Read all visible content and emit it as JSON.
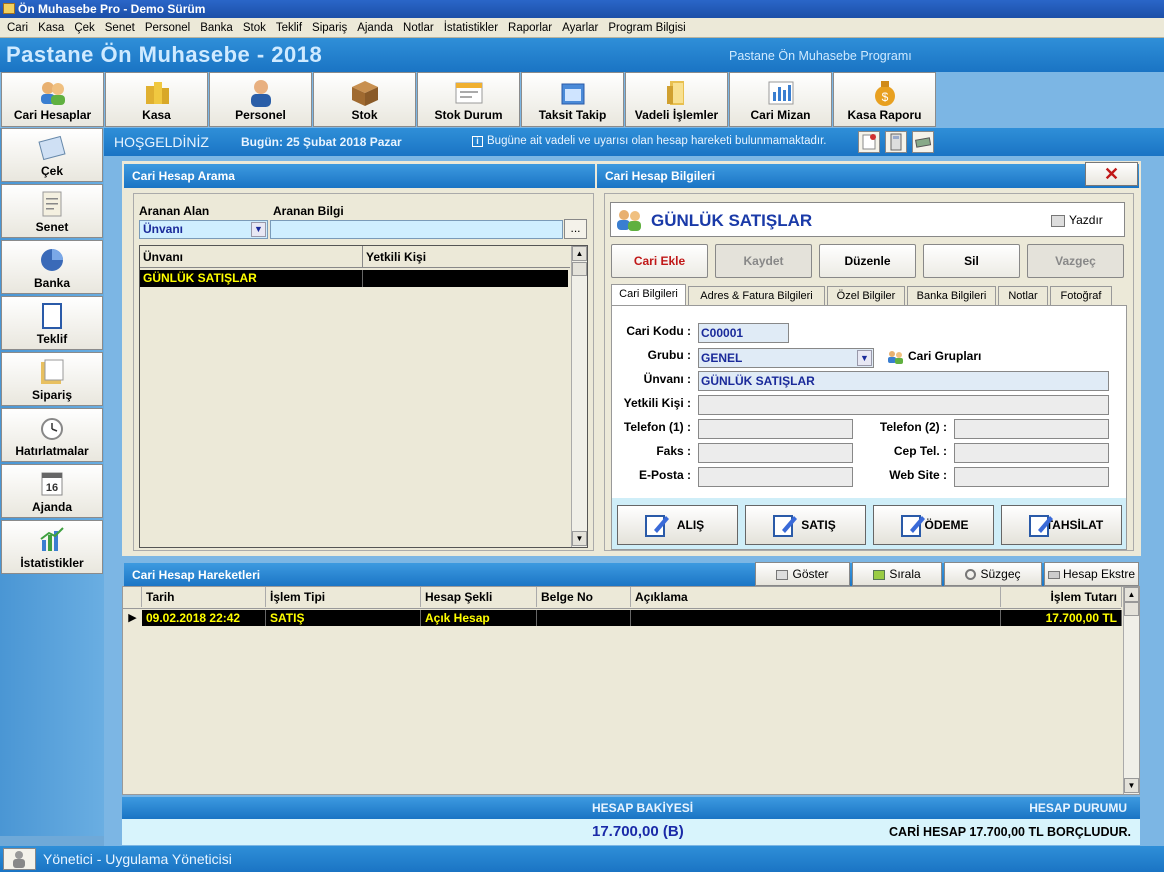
{
  "window": {
    "title": "Ön Muhasebe Pro - Demo Sürüm"
  },
  "menu": [
    "Cari",
    "Kasa",
    "Çek",
    "Senet",
    "Personel",
    "Banka",
    "Stok",
    "Teklif",
    "Sipariş",
    "Ajanda",
    "Notlar",
    "İstatistikler",
    "Raporlar",
    "Ayarlar",
    "Program Bilgisi"
  ],
  "header": {
    "title": "Pastane Ön Muhasebe - 2018",
    "subtitle": "Pastane Ön Muhasebe Programı"
  },
  "toolbar": [
    "Cari Hesaplar",
    "Kasa",
    "Personel",
    "Stok",
    "Stok Durum",
    "Taksit Takip",
    "Vadeli İşlemler",
    "Cari Mizan",
    "Kasa Raporu"
  ],
  "sidebar": [
    "Çek",
    "Senet",
    "Banka",
    "Teklif",
    "Sipariş",
    "Hatırlatmalar",
    "Ajanda",
    "İstatistikler"
  ],
  "welcome": {
    "greeting": "HOŞGELDİNİZ",
    "today": "Bugün: 25 Şubat 2018 Pazar",
    "notice": "Bugüne ait vadeli ve uyarısı olan hesap hareketi bulunmamaktadır."
  },
  "search": {
    "title": "Cari Hesap Arama",
    "field_label": "Aranan Alan",
    "info_label": "Aranan Bilgi",
    "field_value": "Ünvanı",
    "browse": "...",
    "columns": [
      "Ünvanı",
      "Yetkili Kişi"
    ],
    "rows": [
      [
        "GÜNLÜK SATIŞLAR",
        ""
      ]
    ]
  },
  "info": {
    "title": "Cari Hesap Bilgileri",
    "close": "✕",
    "name": "GÜNLÜK SATIŞLAR",
    "print": "Yazdır",
    "buttons": {
      "add": "Cari Ekle",
      "save": "Kaydet",
      "edit": "Düzenle",
      "delete": "Sil",
      "cancel": "Vazgeç"
    },
    "tabs": [
      "Cari Bilgileri",
      "Adres & Fatura Bilgileri",
      "Özel Bilgiler",
      "Banka Bilgileri",
      "Notlar",
      "Fotoğraf"
    ],
    "labels": {
      "code": "Cari Kodu :",
      "group": "Grubu :",
      "title": "Ünvanı :",
      "contact": "Yetkili Kişi :",
      "phone1": "Telefon (1) :",
      "phone2": "Telefon (2) :",
      "fax": "Faks :",
      "mobile": "Cep Tel. :",
      "email": "E-Posta :",
      "web": "Web Site :"
    },
    "values": {
      "code": "C00001",
      "group": "GENEL",
      "title": "GÜNLÜK SATIŞLAR",
      "contact": "",
      "phone1": "",
      "phone2": "",
      "fax": "",
      "mobile": "",
      "email": "",
      "web": ""
    },
    "groups_link": "Cari Grupları",
    "actions": [
      "ALIŞ",
      "SATIŞ",
      "ÖDEME",
      "TAHSİLAT"
    ]
  },
  "movements": {
    "title": "Cari Hesap Hareketleri",
    "buttons": [
      "Göster",
      "Sırala",
      "Süzgeç",
      "Hesap Ekstre"
    ],
    "columns": [
      "Tarih",
      "İşlem Tipi",
      "Hesap Şekli",
      "Belge No",
      "Açıklama",
      "İşlem Tutarı"
    ],
    "rows": [
      [
        "09.02.2018 22:42",
        "SATIŞ",
        "Açık Hesap",
        "",
        "",
        "17.700,00 TL"
      ]
    ]
  },
  "balance": {
    "label": "HESAP BAKİYESİ",
    "value": "17.700,00 (B)",
    "status_label": "HESAP DURUMU",
    "status": "CARİ HESAP 17.700,00 TL BORÇLUDUR."
  },
  "status": {
    "user": "Yönetici - Uygulama Yöneticisi"
  }
}
